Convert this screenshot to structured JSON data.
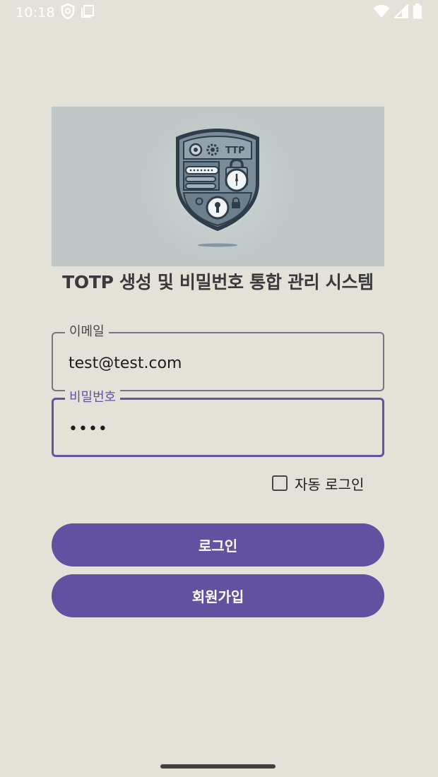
{
  "status_bar": {
    "time": "10:18",
    "left_icons": [
      "shield-icon",
      "sim-card-icon"
    ],
    "right_icons": [
      "wifi-icon",
      "cellular-signal-icon",
      "battery-icon"
    ]
  },
  "app": {
    "title": "TOTP 생성 및 비밀번호 통합 관리 시스템",
    "banner_text": "TTP"
  },
  "form": {
    "email": {
      "label": "이메일",
      "value": "test@test.com"
    },
    "password": {
      "label": "비밀번호",
      "value": "••••"
    },
    "auto_login": {
      "label": "자동 로그인",
      "checked": false
    }
  },
  "buttons": {
    "login": "로그인",
    "signup": "회원가입"
  },
  "colors": {
    "background": "#e4e1d9",
    "primary": "#6250a0",
    "focused_outline": "#6750a4"
  }
}
